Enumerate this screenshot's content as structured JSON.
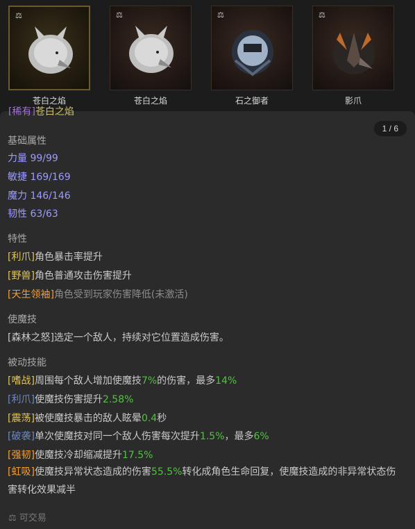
{
  "cards": [
    {
      "name": "苍白之焰",
      "selected": true
    },
    {
      "name": "苍白之焰",
      "selected": false
    },
    {
      "name": "石之御者",
      "selected": false
    },
    {
      "name": "影爪",
      "selected": false
    }
  ],
  "cut_title": {
    "rarity": "[稀有]",
    "name": "苍白之焰"
  },
  "pager": "1 / 6",
  "base": {
    "title": "基础属性",
    "stats": [
      "力量 99/99",
      "敏捷 169/169",
      "魔力 146/146",
      "韧性 63/63"
    ]
  },
  "traits": {
    "title": "特性",
    "items": [
      {
        "tag": "[利爪]",
        "text": "角色暴击率提升"
      },
      {
        "tag": "[野兽]",
        "text": "角色普通攻击伤害提升"
      },
      {
        "tag": "[天生领袖]",
        "text": "角色受到玩家伤害降低(未激活)"
      }
    ]
  },
  "skill": {
    "title": "使魔技",
    "text": "[森林之怒]选定一个敌人，持续对它位置造成伤害。"
  },
  "passive": {
    "title": "被动技能",
    "items": [
      {
        "tag": "[嗜战]",
        "a": "周围每个敌人增加使魔技",
        "v1": "7%",
        "b": "的伤害，最多",
        "v2": "14%"
      },
      {
        "tag": "[利爪]",
        "a": "使魔技伤害提升",
        "v1": "2.58%"
      },
      {
        "tag": "[震荡]",
        "a": "被使魔技暴击的敌人眩晕",
        "v1": "0.4",
        "b": "秒"
      },
      {
        "tag": "[破袭]",
        "a": "单次使魔技对同一个敌人伤害每次提升",
        "v1": "1.5%",
        "b": "，最多",
        "v2": "6%"
      },
      {
        "tag": "[强韧]",
        "a": "使魔技冷却缩减提升",
        "v1": "17.5%"
      },
      {
        "tag": "[虹吸]",
        "a": "使魔技异常状态造成的伤害",
        "v1": "55.5%",
        "b": "转化成角色生命回复，使魔技造成的非异常状态伤害转化效果减半"
      }
    ]
  },
  "trade_label": "可交易"
}
